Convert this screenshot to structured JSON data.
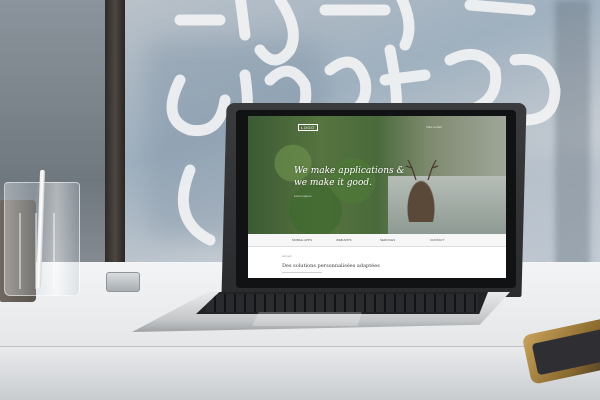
{
  "scene": {
    "window_lettering": "Café afterwork"
  },
  "website": {
    "logo": "LOGO",
    "top_link": "Voici un lien",
    "hero": {
      "line1": "We make applications &",
      "line2": "we make it good.",
      "subtext": "Lorem ipsum"
    },
    "nav": [
      {
        "label": "MOBILE APPS"
      },
      {
        "label": "WEB APPS"
      },
      {
        "label": "SERVICES"
      },
      {
        "label": "CONTACT"
      }
    ],
    "breadcrumb": "Accueil",
    "section_heading": "Des solutions personnalisées adaptées"
  },
  "colors": {
    "hero_text": "#ffffff",
    "nav_background": "#f6f6f6",
    "page_background": "#ffffff"
  }
}
